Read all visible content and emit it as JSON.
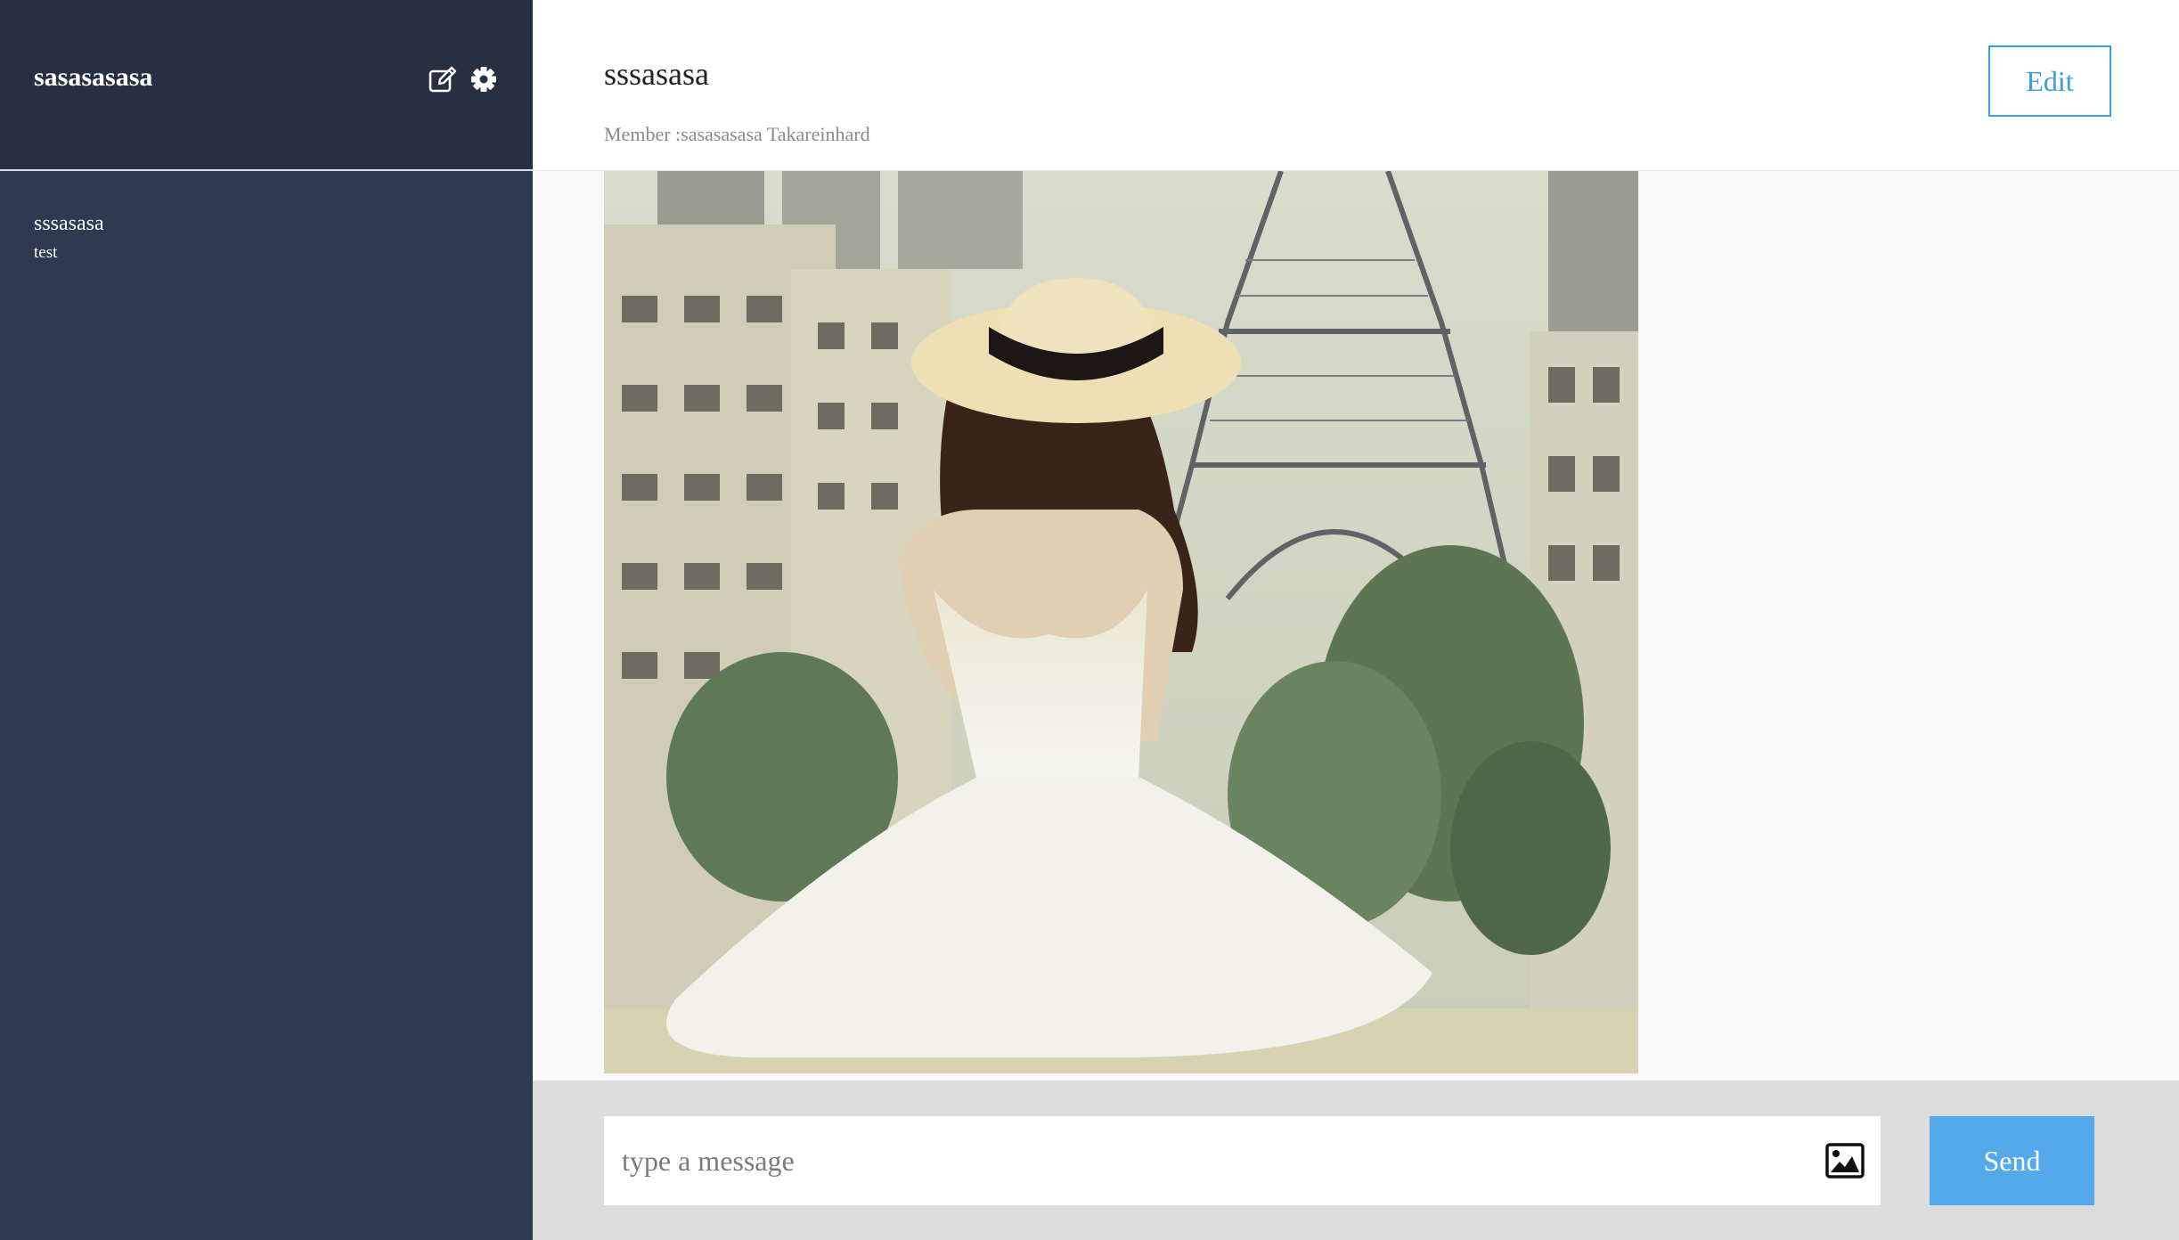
{
  "sidebar": {
    "username": "sasasasasa",
    "conversations": [
      {
        "title": "sssasasa",
        "preview": "test"
      }
    ]
  },
  "chat": {
    "title": "sssasasa",
    "members": "Member :sasasasasa Takareinhard",
    "edit_label": "Edit"
  },
  "composer": {
    "placeholder": "type a message",
    "send_label": "Send"
  },
  "colors": {
    "sidebar_bg": "#2e3a4f",
    "sidebar_header_bg": "#263042",
    "accent": "#3a9ee4",
    "send_bg": "#53a9e9"
  },
  "icons": {
    "compose": "edit-icon",
    "settings": "gear-icon",
    "attach_image": "image-icon"
  }
}
